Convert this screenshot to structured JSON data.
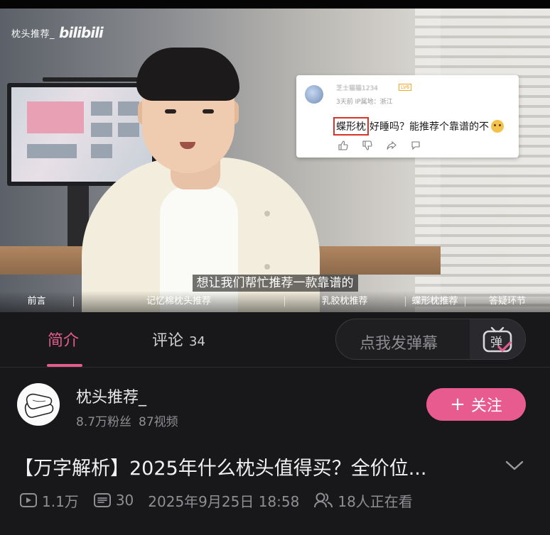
{
  "video": {
    "watermark_user": "枕头推荐_",
    "watermark_logo": "bilibili",
    "subtitle": "想让我们帮忙推荐一款靠谱的",
    "chapters": [
      "前言",
      "记忆棉枕头推荐",
      "乳胶枕推荐",
      "蝶形枕推荐",
      "答疑环节"
    ]
  },
  "comment_card": {
    "username": "芝士猫猫1234",
    "level": "LV6",
    "meta": "3天前 IP属地：浙江",
    "highlight": "蝶形枕",
    "text": "好睡吗？能推荐个靠谱的不",
    "emoji": "cat-face-emoji"
  },
  "tabs": {
    "intro": "简介",
    "comments": "评论",
    "comments_count": "34",
    "danmaku_placeholder": "点我发弹幕",
    "danmaku_icon_char": "弹"
  },
  "uploader": {
    "name": "枕头推荐_",
    "fans": "8.7万粉丝",
    "videos": "87视频",
    "follow_label": "关注"
  },
  "title": "【万字解析】2025年什么枕头值得买？全价位...",
  "stats": {
    "views": "1.1万",
    "danmaku_count": "30",
    "datetime": "2025年9月25日 18:58",
    "watching": "18人正在看"
  },
  "colors": {
    "accent": "#e35d8c",
    "follow_bg": "#e85b8e",
    "background": "#18181a",
    "highlight_border": "#d9342b"
  }
}
